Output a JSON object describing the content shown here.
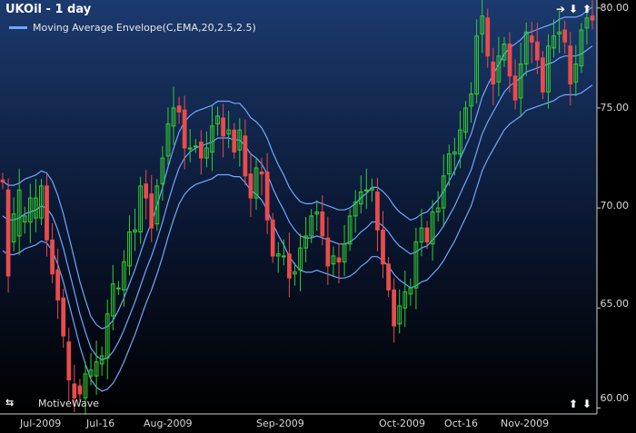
{
  "header": {
    "title": "UKOil - 1 day"
  },
  "legend": {
    "label": "Moving Average Envelope(C,EMA,20,2.5,2.5)"
  },
  "branding": {
    "label": "MotiveWave"
  },
  "colors": {
    "background_top": "#1b3a6e",
    "background_bottom": "#000000",
    "up": "#33cc33",
    "down": "#e84c4c",
    "envelope": "#6fa8ff",
    "axis": "#cfcfcf",
    "text": "#d8d8d8"
  },
  "icons": {
    "scroll_right": "arrow-right-icon",
    "scroll_down": "arrow-down-icon",
    "scroll_up": "arrow-up-icon",
    "pan": "left-right-arrows-icon"
  },
  "chart_data": {
    "type": "candlestick",
    "title": "UKOil - 1 day",
    "xlabel": "",
    "ylabel": "",
    "ylim": [
      59.7,
      80.4
    ],
    "y_ticks": [
      "60.00",
      "65.00",
      "70.00",
      "75.00",
      "80.00"
    ],
    "x_ticks": [
      "Jul-2009",
      "Jul-16",
      "Aug-2009",
      "Sep-2009",
      "Oct-2009",
      "Oct-16",
      "Nov-2009"
    ],
    "candles": [
      [
        71.4,
        71.3
      ],
      [
        70.9,
        66.6
      ],
      [
        68.3,
        69.7
      ],
      [
        68.6,
        70.9
      ],
      [
        69.3,
        69.6
      ],
      [
        69.3,
        70.5
      ],
      [
        69.5,
        70.5
      ],
      [
        69.5,
        71.1
      ],
      [
        71.1,
        68.4
      ],
      [
        68.4,
        66.7
      ],
      [
        66.9,
        65.4
      ],
      [
        65.5,
        63.6
      ],
      [
        63.3,
        61.4
      ],
      [
        61.2,
        60.5
      ],
      [
        61.1,
        60.7
      ],
      [
        60.5,
        61.7
      ],
      [
        61.6,
        61.9
      ],
      [
        61.6,
        62.3
      ],
      [
        62.2,
        62.6
      ],
      [
        62.5,
        64.7
      ],
      [
        64.6,
        66.2
      ],
      [
        66.0,
        66.0
      ],
      [
        65.9,
        67.3
      ],
      [
        67.1,
        68.8
      ],
      [
        68.8,
        68.9
      ],
      [
        68.8,
        71.1
      ],
      [
        71.2,
        70.5
      ],
      [
        70.7,
        69.0
      ],
      [
        69.2,
        71.1
      ],
      [
        71.2,
        72.5
      ],
      [
        72.6,
        74.2
      ],
      [
        74.1,
        75.0
      ],
      [
        75.1,
        74.8
      ],
      [
        74.9,
        73.0
      ],
      [
        73.0,
        73.0
      ],
      [
        73.1,
        73.1
      ],
      [
        73.3,
        72.5
      ],
      [
        72.5,
        73.0
      ],
      [
        72.8,
        74.1
      ],
      [
        74.2,
        74.6
      ],
      [
        74.5,
        73.6
      ],
      [
        73.7,
        73.9
      ],
      [
        73.9,
        72.8
      ],
      [
        72.9,
        73.9
      ],
      [
        73.6,
        71.6
      ],
      [
        71.7,
        70.5
      ],
      [
        70.5,
        72.0
      ],
      [
        71.8,
        71.7
      ],
      [
        71.8,
        69.4
      ],
      [
        69.4,
        67.6
      ],
      [
        67.6,
        67.7
      ],
      [
        67.6,
        67.6
      ],
      [
        67.7,
        66.5
      ],
      [
        66.7,
        66.8
      ],
      [
        66.9,
        68.0
      ],
      [
        68.0,
        68.6
      ],
      [
        68.6,
        69.6
      ],
      [
        69.7,
        69.8
      ],
      [
        69.8,
        68.6
      ],
      [
        68.5,
        67.1
      ],
      [
        67.2,
        67.6
      ],
      [
        67.5,
        67.3
      ],
      [
        67.3,
        68.2
      ],
      [
        68.2,
        69.6
      ],
      [
        69.6,
        70.3
      ],
      [
        70.2,
        70.8
      ],
      [
        70.9,
        70.9
      ],
      [
        70.9,
        71.0
      ],
      [
        70.8,
        68.9
      ],
      [
        68.9,
        67.2
      ],
      [
        67.2,
        65.9
      ],
      [
        65.9,
        64.1
      ],
      [
        64.2,
        65.1
      ],
      [
        65.0,
        65.8
      ],
      [
        65.7,
        66.0
      ],
      [
        66.0,
        68.3
      ],
      [
        68.3,
        69.0
      ],
      [
        69.0,
        68.3
      ],
      [
        68.2,
        69.8
      ],
      [
        69.8,
        70.0
      ],
      [
        70.0,
        71.6
      ],
      [
        71.7,
        72.7
      ],
      [
        72.7,
        72.8
      ],
      [
        72.7,
        73.9
      ],
      [
        73.8,
        75.0
      ],
      [
        75.1,
        75.7
      ],
      [
        75.7,
        78.6
      ],
      [
        78.7,
        79.6
      ],
      [
        79.5,
        77.6
      ],
      [
        77.3,
        76.2
      ],
      [
        76.3,
        77.6
      ],
      [
        77.4,
        78.2
      ],
      [
        78.2,
        76.6
      ],
      [
        76.6,
        75.4
      ],
      [
        75.5,
        77.2
      ],
      [
        77.2,
        78.8
      ],
      [
        78.6,
        78.3
      ],
      [
        78.3,
        77.4
      ],
      [
        77.5,
        75.8
      ],
      [
        75.8,
        78.1
      ],
      [
        78.0,
        78.6
      ],
      [
        78.7,
        78.8
      ],
      [
        78.9,
        78.3
      ],
      [
        78.1,
        76.2
      ],
      [
        76.3,
        77.2
      ],
      [
        77.1,
        78.9
      ],
      [
        79.0,
        79.5
      ],
      [
        79.6,
        79.4
      ]
    ],
    "envelope_middle": [
      69.6,
      69.4,
      69.4,
      69.5,
      69.7,
      69.8,
      69.9,
      70.1,
      70.0,
      69.6,
      68.9,
      68.0,
      66.9,
      65.8,
      64.7,
      63.8,
      63.0,
      62.6,
      62.4,
      62.5,
      62.8,
      63.3,
      63.9,
      64.6,
      65.3,
      66.1,
      66.9,
      67.6,
      68.4,
      69.3,
      70.3,
      71.2,
      72.0,
      72.5,
      72.8,
      73.0,
      73.1,
      73.2,
      73.3,
      73.5,
      73.5,
      73.5,
      73.4,
      73.4,
      73.1,
      72.7,
      72.5,
      72.2,
      71.7,
      71.0,
      70.4,
      69.9,
      69.3,
      68.9,
      68.6,
      68.5,
      68.5,
      68.6,
      68.5,
      68.4,
      68.3,
      68.2,
      68.2,
      68.3,
      68.5,
      68.8,
      69.0,
      69.3,
      69.3,
      69.1,
      68.8,
      68.4,
      68.1,
      67.9,
      67.7,
      67.8,
      68.0,
      68.1,
      68.4,
      68.7,
      69.1,
      69.6,
      70.1,
      70.7,
      71.3,
      71.9,
      72.8,
      73.7,
      74.3,
      74.8,
      75.3,
      75.8,
      76.1,
      76.3,
      76.5,
      76.8,
      76.9,
      77.0,
      77.1,
      77.2,
      77.3,
      77.5,
      77.6,
      77.6,
      77.6,
      77.7,
      77.9,
      78.1
    ]
  }
}
